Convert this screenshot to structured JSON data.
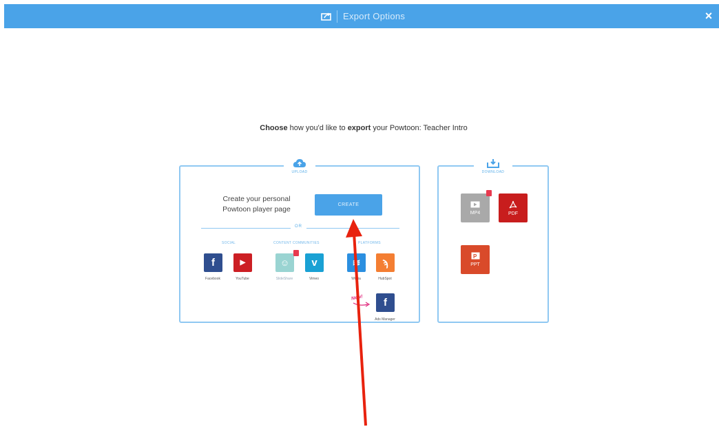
{
  "header": {
    "title": "Export Options",
    "close_symbol": "×",
    "share_icon": "share-export-icon"
  },
  "heading": {
    "part1": "Choose",
    "part2": " how you'd like to ",
    "part3": "export",
    "part4": " your Powtoon: Teacher Intro"
  },
  "upload": {
    "label": "UPLOAD",
    "create_text": "Create your personal Powtoon player page",
    "create_button": "CREATE",
    "or": "OR",
    "categories": [
      "SOCIAL",
      "CONTENT COMMUNITIES",
      "PLATFORMS"
    ],
    "services": [
      {
        "label": "Facebook",
        "glyph": "f",
        "color": "#2f4e8f"
      },
      {
        "label": "YouTube",
        "glyph": "▶",
        "color": "#cc1f24"
      },
      {
        "label": "SlideShare",
        "glyph": "☺",
        "color": "#9ad4d2"
      },
      {
        "label": "Vimeo",
        "glyph": "v",
        "color": "#1aa1d4"
      },
      {
        "label": "Wistia",
        "glyph": "≋",
        "color": "#2b8fe0"
      },
      {
        "label": "HubSpot",
        "glyph": "ϡ",
        "color": "#f47e32"
      },
      {
        "label": "Ads Manager",
        "glyph": "f",
        "color": "#2f4e8f"
      }
    ],
    "new_badge": "New!"
  },
  "download": {
    "label": "DOWNLOAD",
    "items": [
      {
        "label": "MP4",
        "color": "#a9a9a9"
      },
      {
        "label": "PDF",
        "color": "#c81d1d"
      },
      {
        "label": "PPT",
        "color": "#d94a2a"
      }
    ]
  },
  "colors": {
    "accent": "#4aa3e8",
    "border": "#8fc8f2",
    "arrow": "#e8220e"
  }
}
